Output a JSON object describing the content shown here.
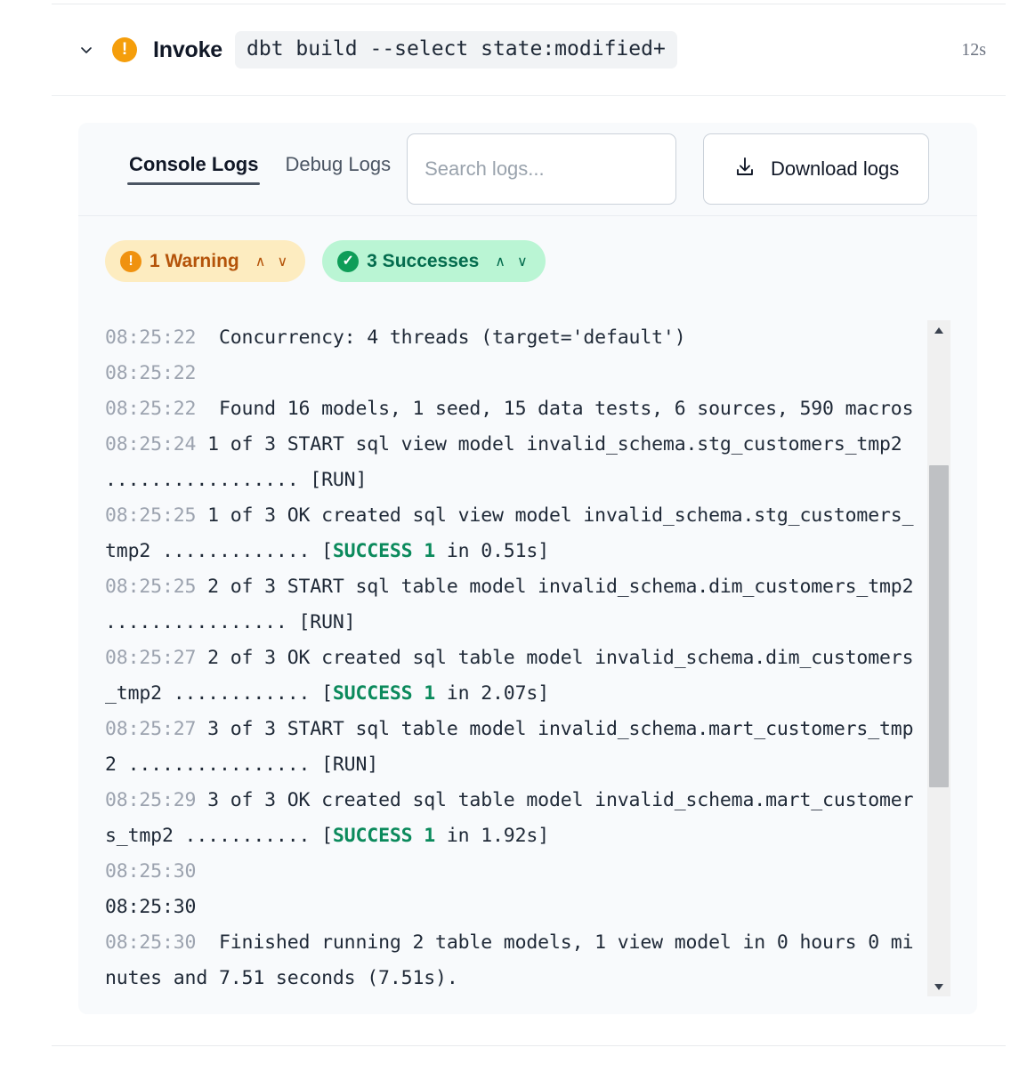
{
  "header": {
    "collapse_icon": "chevron-down-icon",
    "status_icon": "warning-exclamation-icon",
    "title": "Invoke",
    "command": "dbt build --select state:modified+",
    "duration": "12s"
  },
  "toolbar": {
    "tabs": [
      {
        "label": "Console Logs",
        "active": true
      },
      {
        "label": "Debug Logs",
        "active": false
      }
    ],
    "search": {
      "placeholder": "Search logs...",
      "value": ""
    },
    "download": {
      "label": "Download logs",
      "icon": "download-icon"
    }
  },
  "pills": [
    {
      "label": "1 Warning",
      "icon": "warning-exclamation-icon",
      "bg": "#fdecc0",
      "fg": "#b45309",
      "dot": "#f0920f",
      "caret_up": "∧",
      "caret_down": "∨"
    },
    {
      "label": "3 Successes",
      "icon": "check-circle-icon",
      "bg": "#baf5d4",
      "fg": "#046c4e",
      "dot": "#0f9d58",
      "caret_up": "∧",
      "caret_down": "∨"
    }
  ],
  "logs": {
    "scrollbar": {
      "up_arrow": "▲",
      "down_arrow": "▼"
    },
    "lines": [
      {
        "ts": "08:25:22",
        "ts_dark": false,
        "text": "  Concurrency: 4 threads (target='default')"
      },
      {
        "ts": "08:25:22",
        "ts_dark": false,
        "text": ""
      },
      {
        "ts": "08:25:22",
        "ts_dark": false,
        "text": "  Found 16 models, 1 seed, 15 data tests, 6 sources, 590 macros"
      },
      {
        "ts": "08:25:24",
        "ts_dark": false,
        "text": " 1 of 3 START sql view model invalid_schema.stg_customers_tmp2 ................. [RUN]"
      },
      {
        "ts": "08:25:25",
        "ts_dark": false,
        "text": " 1 of 3 OK created sql view model invalid_schema.stg_customers_tmp2 ............. [",
        "ok": "SUCCESS 1",
        "after": " in 0.51s]"
      },
      {
        "ts": "08:25:25",
        "ts_dark": false,
        "text": " 2 of 3 START sql table model invalid_schema.dim_customers_tmp2 ................ [RUN]"
      },
      {
        "ts": "08:25:27",
        "ts_dark": false,
        "text": " 2 of 3 OK created sql table model invalid_schema.dim_customers_tmp2 ............ [",
        "ok": "SUCCESS 1",
        "after": " in 2.07s]"
      },
      {
        "ts": "08:25:27",
        "ts_dark": false,
        "text": " 3 of 3 START sql table model invalid_schema.mart_customers_tmp2 ................ [RUN]"
      },
      {
        "ts": "08:25:29",
        "ts_dark": false,
        "text": " 3 of 3 OK created sql table model invalid_schema.mart_customers_tmp2 ........... [",
        "ok": "SUCCESS 1",
        "after": " in 1.92s]"
      },
      {
        "ts": "08:25:30",
        "ts_dark": false,
        "text": ""
      },
      {
        "ts": "08:25:30",
        "ts_dark": true,
        "text": ""
      },
      {
        "ts": "08:25:30",
        "ts_dark": false,
        "text": "  Finished running 2 table models, 1 view model in 0 hours 0 minutes and 7.51 seconds (7.51s)."
      }
    ]
  }
}
